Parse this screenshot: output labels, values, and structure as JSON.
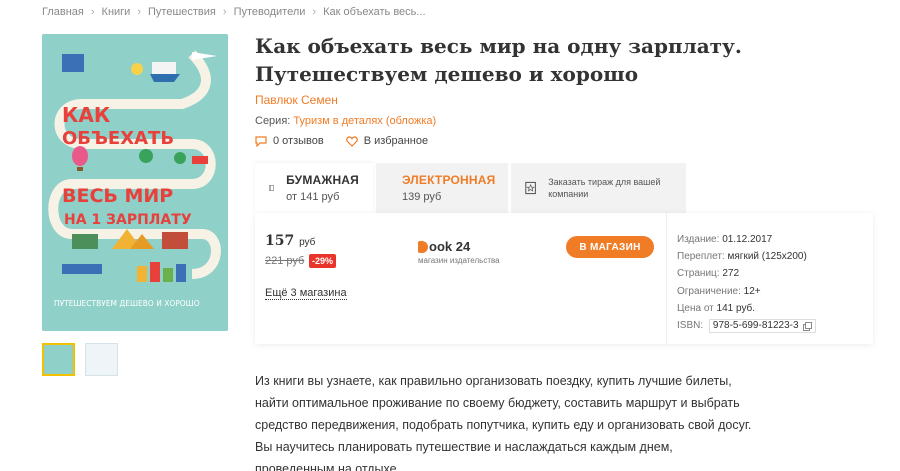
{
  "breadcrumb": {
    "items": [
      "Главная",
      "Книги",
      "Путешествия",
      "Путеводители",
      "Как объехать весь..."
    ]
  },
  "cover": {
    "line1": "КАК",
    "line2": "ОБЪЕХАТЬ",
    "line3": "ВЕСЬ МИР",
    "line4": "НА 1 ЗАРПЛАТУ",
    "line5": "ПУТЕШЕСТВУЕМ ДЕШЕВО И ХОРОШО"
  },
  "book": {
    "title": "Как объехать весь мир на одну зарплату. Путешествуем дешево и хорошо",
    "author": "Павлюк Семен",
    "series_label": "Серия:",
    "series_value": "Туризм в деталях (обложка)",
    "reviews": "0 отзывов",
    "favorite": "В избранное"
  },
  "tabs": {
    "paper_name": "БУМАЖНАЯ",
    "paper_price": "от 141 руб",
    "ebook_name": "ЭЛЕКТРОННАЯ",
    "ebook_price": "139 руб",
    "order_text": "Заказать тираж для вашей компании"
  },
  "offer": {
    "price": "157",
    "price_unit": "руб",
    "old_price": "221 руб",
    "discount": "-29%",
    "store_name": "ook 24",
    "store_sub": "магазин издательства",
    "shop_button": "В МАГАЗИН",
    "more_shops": "Ещё 3 магазина"
  },
  "specs": {
    "published_label": "Издание:",
    "published": "01.12.2017",
    "binding_label": "Переплет:",
    "binding": "мягкий (125x200)",
    "pages_label": "Страниц:",
    "pages": "272",
    "age_label": "Ограничение:",
    "age": "12+",
    "price_from_label": "Цена от",
    "price_from": "141 руб.",
    "isbn_label": "ISBN:",
    "isbn": "978-5-699-81223-3"
  },
  "description": "Из книги вы узнаете, как правильно организовать поездку, купить лучшие билеты, найти оптимальное проживание по своему бюджету, составить маршрут и выбрать средство передвижения, подобрать попутчика, купить еду и организовать свой досуг. Вы научитесь планировать путешествие и наслаждаться каждым днем, проведенным на отдыхе.",
  "colors": {
    "accent": "#f07c26",
    "discount": "#e8342b",
    "cover_bg": "#8fd0c9",
    "cover_red": "#e8403b"
  },
  "icons": {
    "reviews": "speech-bubble-icon",
    "favorite": "heart-icon",
    "paper": "book-icon",
    "ebook": "tablet-icon",
    "order": "star-document-icon",
    "copy": "copy-icon"
  }
}
